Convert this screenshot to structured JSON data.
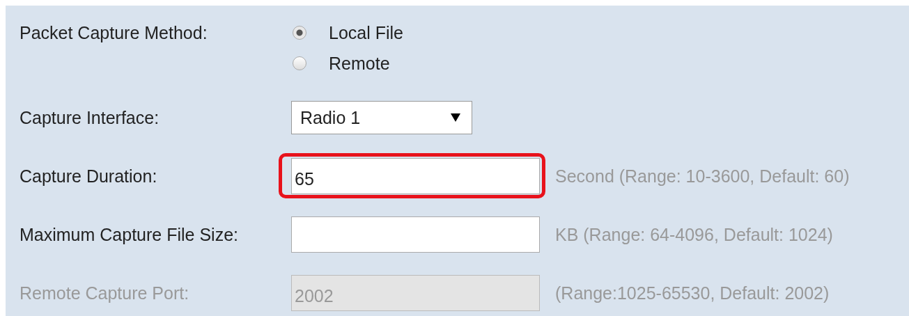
{
  "fields": [
    {
      "kind": "radio",
      "label": "Packet Capture Method:",
      "disabled": false,
      "options": [
        {
          "label": "Local File",
          "selected": true
        },
        {
          "label": "Remote",
          "selected": false
        }
      ]
    },
    {
      "kind": "select",
      "label": "Capture Interface:",
      "value": "Radio 1",
      "disabled": false
    },
    {
      "kind": "text",
      "label": "Capture Duration:",
      "value": "65",
      "hint": "Second (Range: 10-3600, Default: 60)",
      "highlighted": true,
      "disabled": false
    },
    {
      "kind": "text",
      "label": "Maximum Capture File Size:",
      "hint": "KB (Range: 64-4096, Default: 1024)",
      "highlighted": false,
      "disabled": false
    },
    {
      "kind": "text",
      "label": "Remote Capture Port:",
      "value": "2002",
      "hint": "(Range:1025-65530, Default: 2002)",
      "highlighted": false,
      "disabled": true
    }
  ]
}
